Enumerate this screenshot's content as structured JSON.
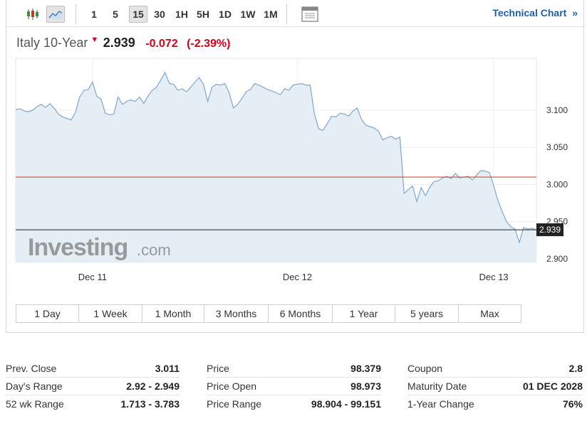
{
  "toolbar": {
    "icons": [
      "candlestick-icon",
      "area-chart-icon",
      "calendar-grid-icon"
    ],
    "intervals": [
      "1",
      "5",
      "15",
      "30",
      "1H",
      "5H",
      "1D",
      "1W",
      "1M"
    ],
    "active_interval": "15",
    "technical_chart_label": "Technical Chart",
    "technical_chart_arrow": "»"
  },
  "quote": {
    "name": "Italy 10-Year",
    "price": "2.939",
    "change": "-0.072",
    "change_pct": "(-2.39%)",
    "direction_arrow": "▼"
  },
  "watermark": {
    "brand": "Investing",
    "suffix": ".com"
  },
  "chart_data": {
    "type": "area",
    "x_tick_labels": [
      "Dec 11",
      "Dec 12",
      "Dec 13"
    ],
    "y_ticks": [
      2.9,
      2.95,
      3.0,
      3.05,
      3.1
    ],
    "y_tick_labels": [
      "2.900",
      "2.950",
      "3.000",
      "3.050",
      "3.100"
    ],
    "ylim": [
      2.895,
      3.17
    ],
    "current_value": 2.939,
    "current_label": "2.939",
    "reference_value": 3.01,
    "colors": {
      "line": "#7fa8cf",
      "fill": "#e6eef5",
      "reference": "#c0392b",
      "current": "#222222"
    },
    "series": [
      {
        "values": [
          3.101,
          3.102,
          3.099,
          3.098,
          3.1,
          3.105,
          3.108,
          3.104,
          3.109,
          3.103,
          3.095,
          3.091,
          3.089,
          3.087,
          3.097,
          3.118,
          3.127,
          3.128,
          3.138,
          3.119,
          3.115,
          3.096,
          3.094,
          3.095,
          3.118,
          3.108,
          3.112,
          3.114,
          3.112,
          3.118,
          3.109,
          3.119,
          3.127,
          3.131,
          3.141,
          3.151,
          3.136,
          3.135,
          3.127,
          3.129,
          3.125,
          3.131,
          3.138,
          3.144,
          3.135,
          3.112,
          3.131,
          3.135,
          3.134,
          3.136,
          3.124,
          3.103,
          3.108,
          3.116,
          3.125,
          3.128,
          3.136,
          3.134,
          3.131,
          3.128,
          3.126,
          3.124,
          3.121,
          3.129,
          3.127,
          3.134,
          3.135,
          3.136,
          3.134,
          3.134,
          3.095,
          3.075,
          3.073,
          3.082,
          3.092,
          3.091,
          3.096,
          3.095,
          3.092,
          3.099,
          3.103,
          3.088,
          3.08,
          3.078,
          3.076,
          3.072,
          3.06,
          3.063,
          3.065,
          3.061,
          3.064,
          2.988,
          2.993,
          2.998,
          2.977,
          2.996,
          2.985,
          2.996,
          3.004,
          3.005,
          3.009,
          3.011,
          3.008,
          3.015,
          3.009,
          3.01,
          3.011,
          3.006,
          3.013,
          3.019,
          3.018,
          3.016,
          2.998,
          2.978,
          2.963,
          2.95,
          2.943,
          2.94,
          2.922,
          2.942,
          2.94,
          2.941,
          2.939
        ]
      }
    ]
  },
  "ranges": [
    "1 Day",
    "1 Week",
    "1 Month",
    "3 Months",
    "6 Months",
    "1 Year",
    "5 years",
    "Max"
  ],
  "stats": [
    [
      {
        "label": "Prev. Close",
        "value": "3.011"
      },
      {
        "label": "Day's Range",
        "value": "2.92 - 2.949"
      },
      {
        "label": "52 wk Range",
        "value": "1.713 - 3.783"
      }
    ],
    [
      {
        "label": "Price",
        "value": "98.379"
      },
      {
        "label": "Price Open",
        "value": "98.973"
      },
      {
        "label": "Price Range",
        "value": "98.904 - 99.151"
      }
    ],
    [
      {
        "label": "Coupon",
        "value": "2.8"
      },
      {
        "label": "Maturity Date",
        "value": "01 DEC 2028"
      },
      {
        "label": "1-Year Change",
        "value": "76%"
      }
    ]
  ]
}
